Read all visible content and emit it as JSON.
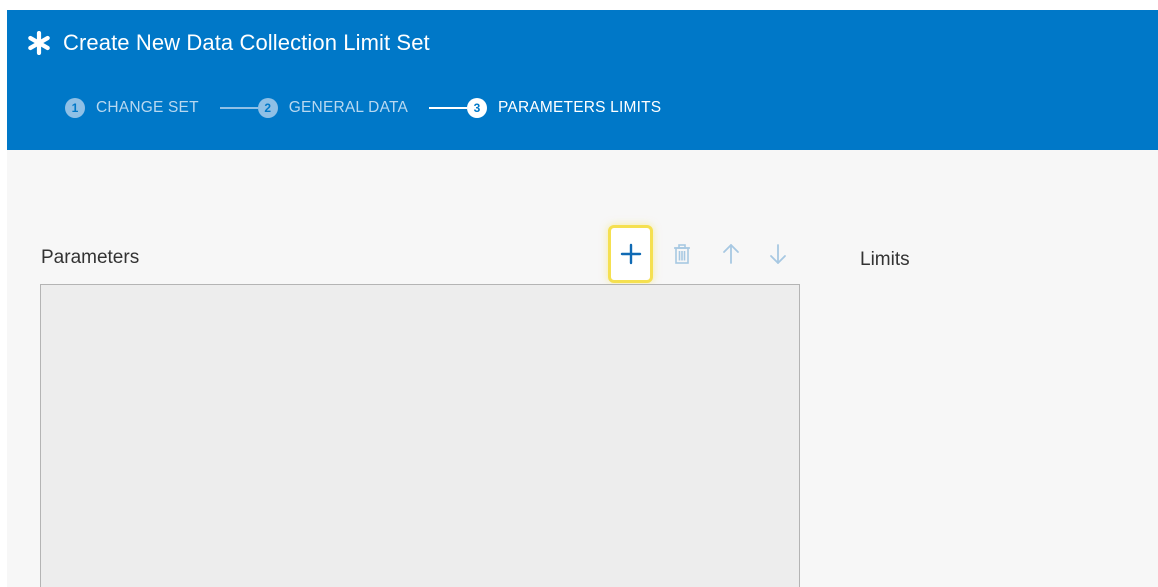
{
  "header": {
    "title": "Create New Data Collection Limit Set",
    "title_icon": "asterisk-icon",
    "background_color": "#0078c8"
  },
  "wizard": {
    "steps": [
      {
        "number": "1",
        "label": "CHANGE SET",
        "state": "inactive"
      },
      {
        "number": "2",
        "label": "GENERAL DATA",
        "state": "inactive"
      },
      {
        "number": "3",
        "label": "PARAMETERS LIMITS",
        "state": "active"
      }
    ]
  },
  "parameters": {
    "label": "Parameters",
    "toolbar": {
      "add_icon": "plus-icon",
      "delete_icon": "trash-icon",
      "move_up_icon": "arrow-up-icon",
      "move_down_icon": "arrow-down-icon",
      "highlight_color": "#f5e050"
    },
    "items": []
  },
  "limits": {
    "label": "Limits"
  }
}
